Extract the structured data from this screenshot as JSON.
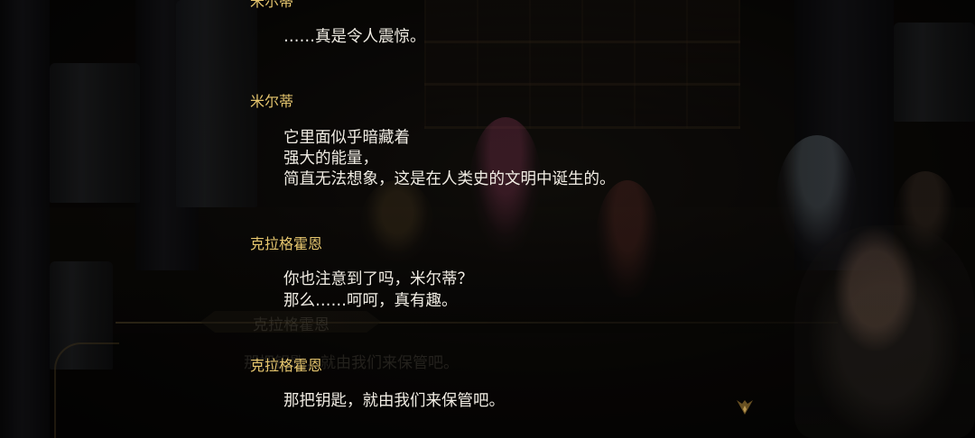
{
  "backlog": {
    "entries": [
      {
        "speaker": "米尔蒂",
        "lines": [
          "……真是令人震惊。"
        ]
      },
      {
        "speaker": "米尔蒂",
        "lines": [
          "它里面似乎暗藏着",
          "强大的能量，",
          "简直无法想象，这是在人类史的文明中诞生的。"
        ]
      },
      {
        "speaker": "克拉格霍恩",
        "lines": [
          "你也注意到了吗，米尔蒂？",
          "那么……呵呵，真有趣。"
        ]
      },
      {
        "speaker": "克拉格霍恩",
        "lines": [
          "那把钥匙，就由我们来保管吧。"
        ]
      }
    ]
  },
  "background_dialog": {
    "speaker": "克拉格霍恩",
    "text": "那把钥匙，就由我们来保管吧。"
  },
  "colors": {
    "speaker": "#e6c66e",
    "text": "#f1ede4"
  },
  "icons": {
    "advance": "ornate-arrow-down-icon"
  }
}
